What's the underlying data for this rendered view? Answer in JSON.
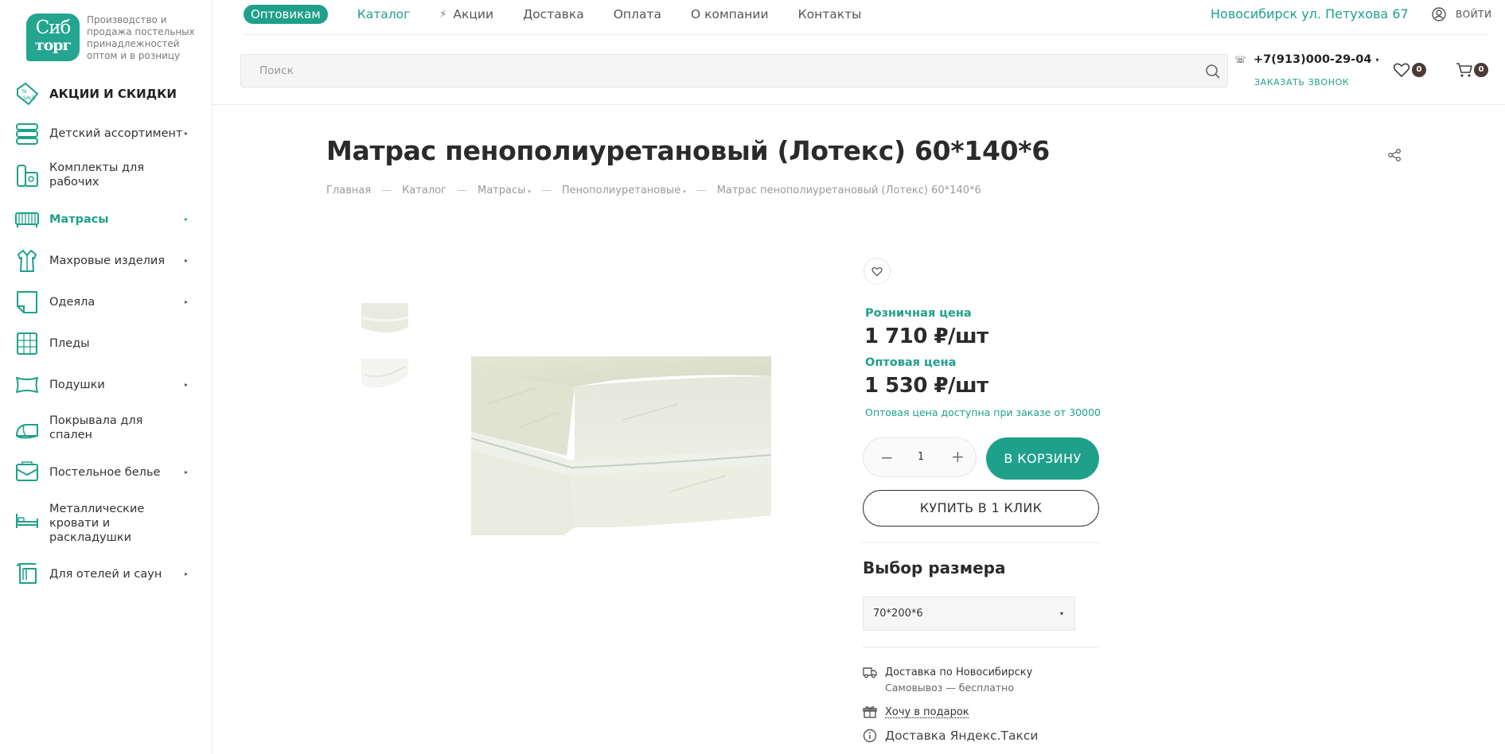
{
  "brand": {
    "logo_line1": "Сиб",
    "logo_line2": "торг",
    "tagline": "Производство и продажа постельных принадлежностей оптом и в розницу"
  },
  "sidebar": {
    "items": [
      {
        "label": "АКЦИИ И СКИДКИ",
        "icon": "sale-tag-icon"
      },
      {
        "label": "Детский ассортимент",
        "icon": "stack-icon"
      },
      {
        "label": "Комплекты для рабочих",
        "icon": "worker-kit-icon"
      },
      {
        "label": "Матрасы",
        "icon": "mattress-icon"
      },
      {
        "label": "Махровые изделия",
        "icon": "robe-icon"
      },
      {
        "label": "Одеяла",
        "icon": "blanket-icon"
      },
      {
        "label": "Пледы",
        "icon": "plaid-icon"
      },
      {
        "label": "Подушки",
        "icon": "pillow-icon"
      },
      {
        "label": "Покрывала для спален",
        "icon": "bedspread-icon"
      },
      {
        "label": "Постельное белье",
        "icon": "bed-linen-icon"
      },
      {
        "label": "Металлические кровати и раскладушки",
        "icon": "bed-icon"
      },
      {
        "label": "Для отелей и саун",
        "icon": "hotel-icon"
      }
    ],
    "active": "Матрасы"
  },
  "topnav": {
    "wholesale": "Оптовикам",
    "catalog": "Каталог",
    "promo": "Акции",
    "delivery": "Доставка",
    "payment": "Оплата",
    "about": "О компании",
    "contacts": "Контакты"
  },
  "header": {
    "city": "Новосибирск ул. Петухова 67",
    "login": "ВОЙТИ",
    "search_placeholder": "Поиск",
    "phone": "+7(913)000-29-04",
    "callback": "ЗАКАЗАТЬ ЗВОНОК",
    "favorites_count": "0",
    "cart_count": "0"
  },
  "product": {
    "title": "Матрас пенополиуретановый (Лотекс) 60*140*6",
    "breadcrumb": [
      "Главная",
      "Каталог",
      "Матрасы",
      "Пенополиуретановые",
      "Матрас пенополиуретановый (Лотекс) 60*140*6"
    ],
    "retail_label": "Розничная цена",
    "retail_price": "1 710 ₽/шт",
    "wholesale_label": "Оптовая цена",
    "wholesale_price": "1 530 ₽/шт",
    "wholesale_note": "Оптовая цена доступна при заказе от 30000",
    "quantity": "1",
    "add_to_cart": "В КОРЗИНУ",
    "buy_one_click": "КУПИТЬ В 1 КЛИК",
    "size_title": "Выбор размера",
    "size_selected": "70*200*6",
    "delivery_city": "Доставка по Новосибирску",
    "pickup": "Самовывоз — бесплатно",
    "gift": "Хочу в подарок",
    "yandex_taxi": "Доставка Яндекс.Такси"
  },
  "colors": {
    "accent": "#1fa08a",
    "badge": "#4a3b35"
  }
}
